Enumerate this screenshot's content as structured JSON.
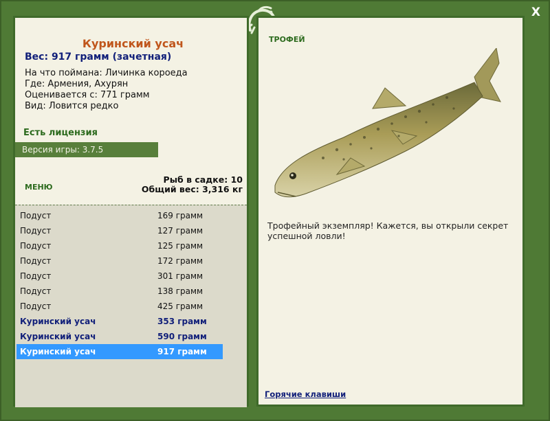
{
  "window": {
    "close_label": "X"
  },
  "fish": {
    "name": "Куринский усач",
    "weight_line": "Вес: 917 грамм (зачетная)",
    "bait_line": "На что поймана: Личинка короеда",
    "location_line": "Где: Армения, Ахурян",
    "rating_line": "Оценивается с: 771 грамм",
    "species_line": "Вид: Ловится редко"
  },
  "license": "Есть лицензия",
  "version": "Версия игры: 3.7.5",
  "menu_label": "МЕНЮ",
  "cage": {
    "count_line": "Рыб в садке: 10",
    "total_line": "Общий вес: 3,316 кг"
  },
  "catch_list": [
    {
      "name": "Подуст",
      "weight": "169 грамм",
      "style": "normal"
    },
    {
      "name": "Подуст",
      "weight": "127 грамм",
      "style": "normal"
    },
    {
      "name": "Подуст",
      "weight": "125 грамм",
      "style": "normal"
    },
    {
      "name": "Подуст",
      "weight": "172 грамм",
      "style": "normal"
    },
    {
      "name": "Подуст",
      "weight": "301 грамм",
      "style": "normal"
    },
    {
      "name": "Подуст",
      "weight": "138 грамм",
      "style": "normal"
    },
    {
      "name": "Подуст",
      "weight": "425 грамм",
      "style": "normal"
    },
    {
      "name": "Куринский усач",
      "weight": "353 грамм",
      "style": "blue"
    },
    {
      "name": "Куринский усач",
      "weight": "590 грамм",
      "style": "blue"
    },
    {
      "name": "Куринский усач",
      "weight": "917 грамм",
      "style": "selected"
    }
  ],
  "trophy_label": "ТРОФЕЙ",
  "trophy_text": "Трофейный экземпляр! Кажется, вы открыли секрет успешной ловли!",
  "hotkeys_label": "Горячие клавиши",
  "colors": {
    "frame": "#4f7a35",
    "panel": "#f4f2e4",
    "selected": "#3399ff",
    "title": "#c0561c",
    "blue_text": "#12207a"
  }
}
